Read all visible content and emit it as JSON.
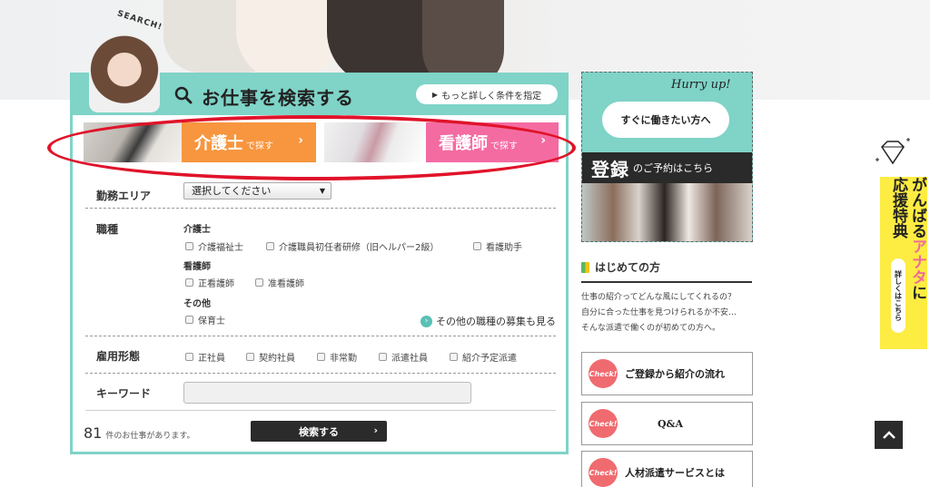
{
  "hero": {
    "search_badge": "SEARCH!"
  },
  "search_panel": {
    "title": "お仕事を検索する",
    "more_conditions": "もっと詳しく条件を指定",
    "categories": [
      {
        "label": "介護士",
        "suffix": "で探す"
      },
      {
        "label": "看護師",
        "suffix": "で探す"
      }
    ],
    "area": {
      "label": "勤務エリア",
      "select_value": "選択してください"
    },
    "job": {
      "label": "職種",
      "groups": [
        {
          "title": "介護士",
          "options": [
            "介護福祉士",
            "介護職員初任者研修（旧ヘルパー2級）",
            "看護助手"
          ]
        },
        {
          "title": "看護師",
          "options": [
            "正看護師",
            "准看護師"
          ]
        },
        {
          "title": "その他",
          "options": [
            "保育士"
          ]
        }
      ],
      "other_link": "その他の職種の募集も見る"
    },
    "employment": {
      "label": "雇用形態",
      "options": [
        "正社員",
        "契約社員",
        "非常勤",
        "派遣社員",
        "紹介予定派遣"
      ]
    },
    "keyword": {
      "label": "キーワード",
      "value": ""
    },
    "count": "81",
    "count_suffix": "件のお仕事があります。",
    "search_button": "検索する"
  },
  "banner": {
    "hurry": "Hurry up!",
    "bubble": "すぐに働きたい方へ",
    "strip_big": "登録",
    "strip_small": "のご予約はこちら"
  },
  "first_time": {
    "title": "はじめての方",
    "desc": [
      "仕事の紹介ってどんな風にしてくれるの？",
      "自分に合った仕事を見つけられるか不安…",
      "そんな派遣で働くのが初めての方へ。"
    ],
    "items": [
      {
        "badge": "Check!",
        "label": "ご登録から紹介の流れ"
      },
      {
        "badge": "Check!",
        "label": "Q&A"
      },
      {
        "badge": "Check!",
        "label": "人材派遣サービスとは"
      }
    ]
  },
  "side_banner": {
    "line1": "がんばる",
    "line1_pink": "アナタ",
    "line1_end": "に",
    "line2": "応援特典",
    "more": "詳しくはこちら"
  },
  "colors": {
    "teal": "#7fd3c7",
    "orange": "#f7963f",
    "pink": "#f46ba2",
    "annotation_red": "#e0132a",
    "yellow": "#fdec42"
  }
}
